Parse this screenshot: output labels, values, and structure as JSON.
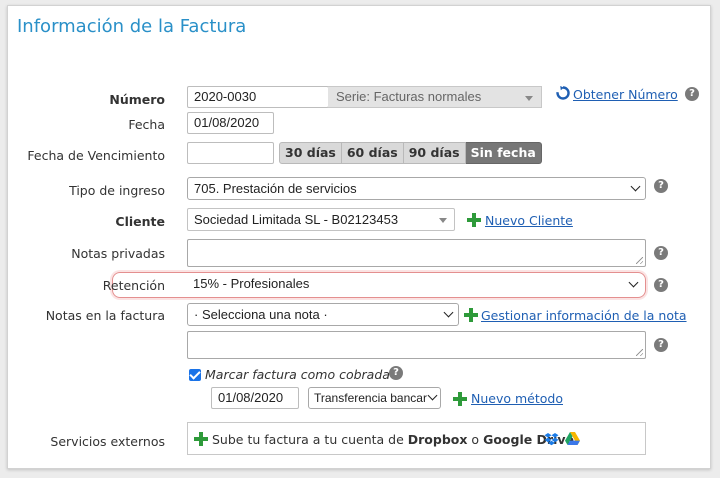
{
  "title": "Información de la Factura",
  "numero": {
    "label": "Número",
    "value": "2020-0030",
    "serie": "Serie: Facturas normales",
    "obtener_link": "Obtener Número"
  },
  "fecha": {
    "label": "Fecha",
    "value": "01/08/2020"
  },
  "vencimiento": {
    "label": "Fecha de Vencimiento",
    "value": "",
    "buttons": [
      "30 días",
      "60 días",
      "90 días",
      "Sin fecha"
    ],
    "active_button": "Sin fecha"
  },
  "tipo_ingreso": {
    "label": "Tipo de ingreso",
    "value": "705. Prestación de servicios"
  },
  "cliente": {
    "label": "Cliente",
    "value": "Sociedad Limitada SL - B02123453",
    "nuevo_link": "Nuevo Cliente"
  },
  "notas_privadas": {
    "label": "Notas privadas",
    "value": ""
  },
  "retencion": {
    "label": "Retención",
    "value": "15% - Profesionales",
    "highlight_color": "#e48f8f"
  },
  "notas_factura": {
    "label": "Notas en la factura",
    "select_value": "· Selecciona una nota ·",
    "gestionar_link": "Gestionar información de la nota",
    "text_value": ""
  },
  "cobrada": {
    "checkbox_label": "Marcar factura como cobrada",
    "checked": true,
    "fecha": "01/08/2020",
    "metodo": "Transferencia bancar",
    "nuevo_metodo_link": "Nuevo método"
  },
  "servicios": {
    "label": "Servicios externos",
    "text_prefix": "Sube tu factura a tu cuenta de ",
    "dropbox": "Dropbox",
    "middle": " o ",
    "gdrive": "Google Drive"
  },
  "help_glyph": "?",
  "colors": {
    "accent": "#2a90c8",
    "link": "#1f5fb3",
    "plus_green": "#2e9a3a",
    "checkbox": "#1a73e8"
  },
  "icons": [
    "refresh-icon",
    "help-icon",
    "plus-icon",
    "dropbox-icon",
    "google-drive-icon",
    "chevron-down-icon"
  ]
}
